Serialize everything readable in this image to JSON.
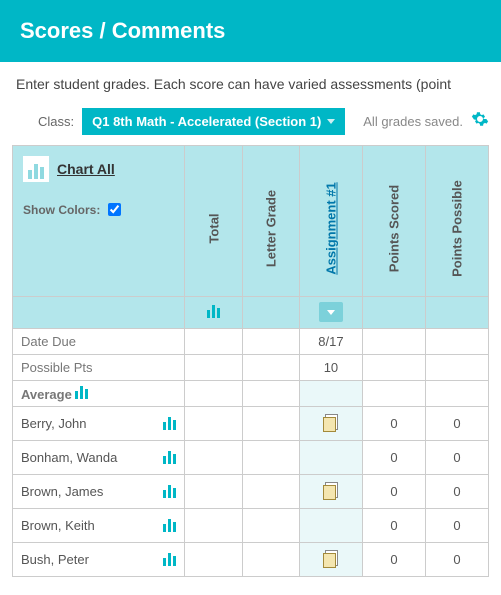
{
  "header": {
    "title": "Scores / Comments"
  },
  "subtext": "Enter student grades. Each score can have varied assessments (point",
  "controls": {
    "class_label": "Class:",
    "class_value": "Q1 8th Math - Accelerated (Section 1)",
    "saved_text": "All grades saved."
  },
  "name_head": {
    "chart_all": "Chart All",
    "show_colors": "Show Colors:",
    "show_colors_checked": true
  },
  "columns": {
    "total": "Total",
    "letter": "Letter Grade",
    "assignment": "Assignment #1",
    "scored": "Points Scored",
    "possible": "Points Possible"
  },
  "meta_rows": {
    "date_due": {
      "label": "Date Due",
      "assignment": "8/17"
    },
    "possible_pts": {
      "label": "Possible Pts",
      "assignment": "10"
    },
    "average": {
      "label": "Average"
    }
  },
  "students": [
    {
      "name": "Berry, John",
      "has_note": true,
      "scored": "0",
      "possible": "0"
    },
    {
      "name": "Bonham, Wanda",
      "has_note": false,
      "scored": "0",
      "possible": "0"
    },
    {
      "name": "Brown, James",
      "has_note": true,
      "scored": "0",
      "possible": "0"
    },
    {
      "name": "Brown, Keith",
      "has_note": false,
      "scored": "0",
      "possible": "0"
    },
    {
      "name": "Bush, Peter",
      "has_note": true,
      "scored": "0",
      "possible": "0"
    }
  ]
}
